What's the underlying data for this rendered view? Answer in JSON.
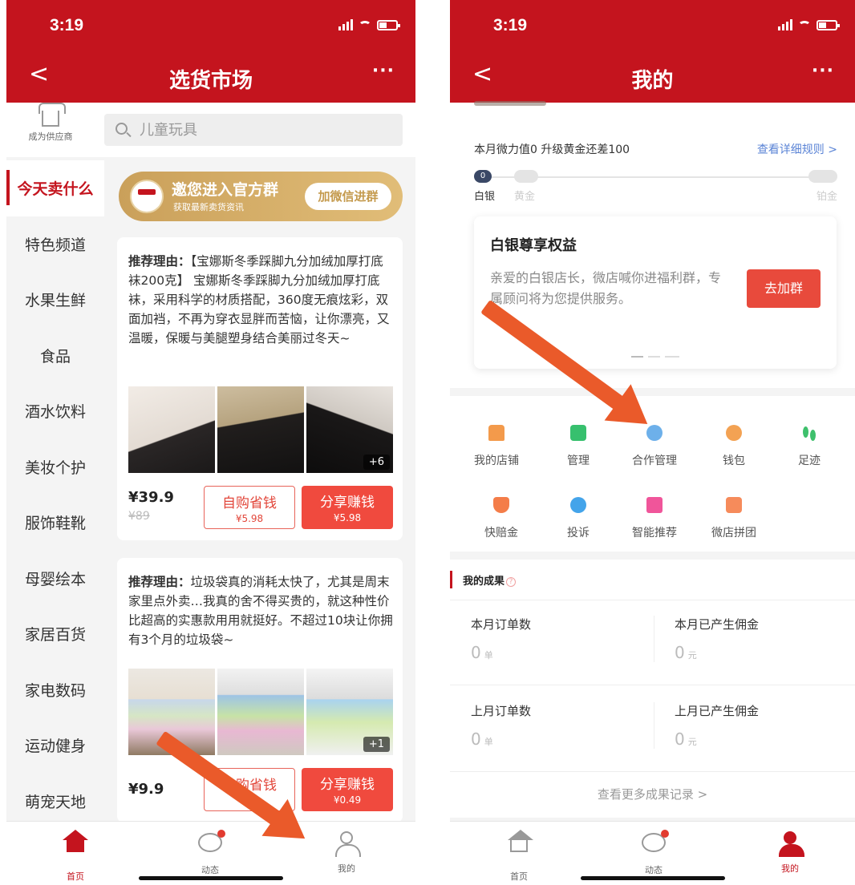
{
  "left": {
    "status": {
      "time": "3:19"
    },
    "nav": {
      "back": "<",
      "title": "选货市场",
      "more": "···"
    },
    "supplier_label": "成为供应商",
    "search": {
      "placeholder": "儿童玩具"
    },
    "categories": [
      "今天卖什么",
      "特色频道",
      "水果生鲜",
      "食品",
      "酒水饮料",
      "美妆个护",
      "服饰鞋靴",
      "母婴绘本",
      "家居百货",
      "家电数码",
      "运动健身",
      "萌宠天地"
    ],
    "banner": {
      "title": "邀您进入官方群",
      "subtitle": "获取最新卖货资讯",
      "button": "加微信进群"
    },
    "cards": [
      {
        "reason_label": "推荐理由：",
        "reason_text": "【宝娜斯冬季踩脚九分加绒加厚打底袜200克】 宝娜斯冬季踩脚九分加绒加厚打底袜，采用科学的材质搭配，360度无痕炫彩，双面加裆，不再为穿衣显胖而苦恼，让你漂亮，又温暖，保暖与美腿塑身结合美丽过冬天~",
        "more_images": "+6",
        "price": "¥39.9",
        "original_price": "¥89",
        "self_buy": "自购省钱",
        "self_buy_amount": "¥5.98",
        "share": "分享赚钱",
        "share_amount": "¥5.98"
      },
      {
        "reason_label": "推荐理由：",
        "reason_text": "垃圾袋真的消耗太快了，尤其是周末家里点外卖…我真的舍不得买贵的，就这种性价比超高的实惠款用用就挺好。不超过10块让你拥有3个月的垃圾袋~",
        "more_images": "+1",
        "price": "¥9.9",
        "self_buy": "自购省钱",
        "share": "分享赚钱",
        "share_amount": "¥0.49"
      }
    ],
    "tabs": {
      "home": "首页",
      "dynamic": "动态",
      "mine": "我的"
    }
  },
  "right": {
    "status": {
      "time": "3:19"
    },
    "nav": {
      "back": "<",
      "title": "我的",
      "more": "···"
    },
    "weili": {
      "text": "本月微力值0 升级黄金还差100",
      "link": "查看详细规则 >"
    },
    "levels": {
      "current_value": "0",
      "silver": "白银",
      "gold": "黄金",
      "platinum": "铂金"
    },
    "benefit": {
      "title": "白银尊享权益",
      "desc": "亲爱的白银店长，微店喊你进福利群，专属顾问将为您提供服务。",
      "button": "去加群"
    },
    "menu": [
      {
        "label": "我的店铺",
        "icon": "store-icon"
      },
      {
        "label": "管理",
        "icon": "manage-icon"
      },
      {
        "label": "合作管理",
        "icon": "cooperation-icon"
      },
      {
        "label": "钱包",
        "icon": "wallet-icon"
      },
      {
        "label": "足迹",
        "icon": "footprint-icon"
      },
      {
        "label": "快赔金",
        "icon": "fast-compensation-icon"
      },
      {
        "label": "投诉",
        "icon": "complaint-icon"
      },
      {
        "label": "智能推荐",
        "icon": "smart-recommend-icon"
      },
      {
        "label": "微店拼团",
        "icon": "group-buy-icon"
      }
    ],
    "results": {
      "title": "我的成果",
      "help": "?",
      "stats": [
        {
          "label": "本月订单数",
          "value": "0",
          "unit": "单"
        },
        {
          "label": "本月已产生佣金",
          "value": "0",
          "unit": "元"
        },
        {
          "label": "上月订单数",
          "value": "0",
          "unit": "单"
        },
        {
          "label": "上月已产生佣金",
          "value": "0",
          "unit": "元"
        }
      ],
      "more": "查看更多成果记录 >"
    },
    "tabs": {
      "home": "首页",
      "dynamic": "动态",
      "mine": "我的"
    }
  },
  "colors": {
    "brand_red": "#c4141e",
    "arrow_orange": "#ea5a2a",
    "link_blue": "#5b84d6"
  }
}
